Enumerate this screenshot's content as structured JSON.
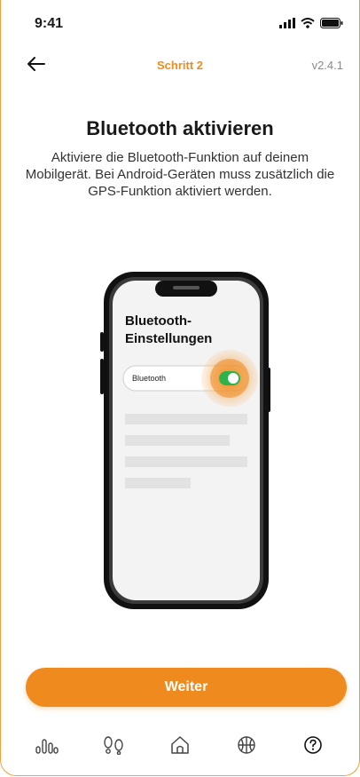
{
  "status_bar": {
    "time": "9:41"
  },
  "header": {
    "step_label": "Schritt 2",
    "version": "v2.4.1"
  },
  "main": {
    "title": "Bluetooth aktivieren",
    "description": "Aktiviere die Bluetooth-Funktion auf deinem Mobilgerät. Bei Android-Geräten muss zusätzlich die GPS-Funktion aktiviert werden."
  },
  "illustration": {
    "settings_title_line1": "Bluetooth-",
    "settings_title_line2": "Einstellungen",
    "toggle_label": "Bluetooth",
    "toggle_on": true
  },
  "actions": {
    "next_label": "Weiter"
  },
  "nav": {
    "icons": [
      "stats-icon",
      "footprints-icon",
      "home-icon",
      "basketball-icon",
      "help-icon"
    ]
  },
  "colors": {
    "accent": "#ef8a1f",
    "toggle_on": "#2eb34a",
    "text": "#1a1a1a",
    "muted": "#888888"
  }
}
